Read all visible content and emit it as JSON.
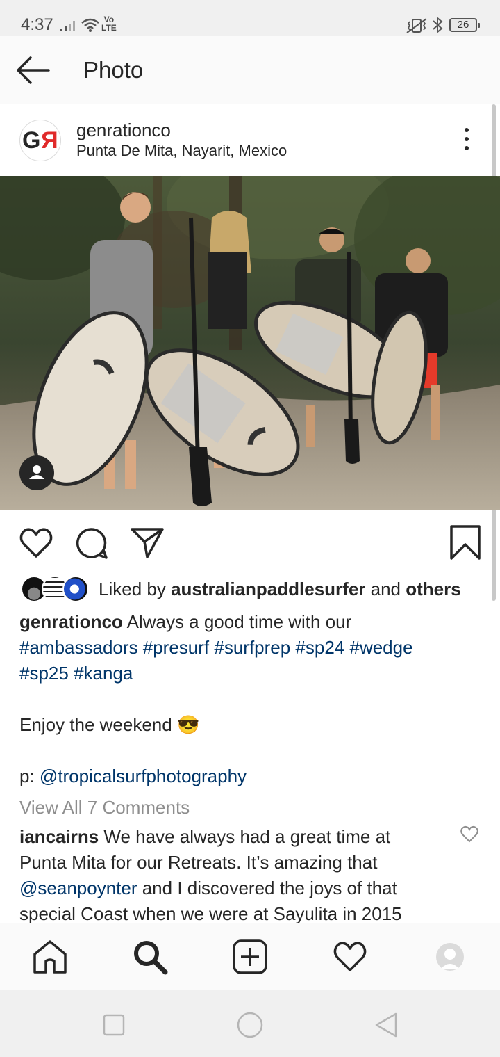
{
  "status_bar": {
    "time": "4:37",
    "volte_top": "Vo",
    "volte_bottom": "LTE",
    "battery": "26"
  },
  "header": {
    "title": "Photo"
  },
  "post": {
    "username": "genrationco",
    "location": "Punta De Mita, Nayarit, Mexico",
    "avatar_letters": "GR",
    "likes": {
      "prefix": "Liked by ",
      "user": "australianpaddlesurfer",
      "middle": " and ",
      "others": "others"
    },
    "caption": {
      "username": "genrationco",
      "text": " Always a good time with our",
      "hashtags_line1": "#ambassadors #presurf #surfprep #sp24 #wedge",
      "hashtags_line2": "#sp25 #kanga",
      "enjoy": "Enjoy the weekend ",
      "emoji": "😎",
      "credit_prefix": "p: ",
      "credit_handle": "@tropicalsurfphotography"
    },
    "view_all_comments": "View All 7 Comments",
    "comment": {
      "username": "iancairns",
      "text1": " We have always had a great time at",
      "text2": "Punta Mita for our Retreats. It’s amazing that",
      "mention": "@seanpoynter",
      "text3": " and I discovered the joys of that",
      "text4": "special Coast when we were at Sayulita in 2015"
    }
  },
  "icons": {
    "back": "arrow-left-icon",
    "more": "more-vertical-icon",
    "like": "heart-icon",
    "comment": "comment-bubble-icon",
    "share": "paper-plane-icon",
    "save": "bookmark-icon",
    "home": "home-icon",
    "search": "search-icon",
    "add": "plus-square-icon",
    "activity": "heart-icon",
    "profile": "avatar-icon"
  },
  "colors": {
    "link": "#003569",
    "muted": "#8e8e8e",
    "brand_red": "#e02a2a"
  }
}
